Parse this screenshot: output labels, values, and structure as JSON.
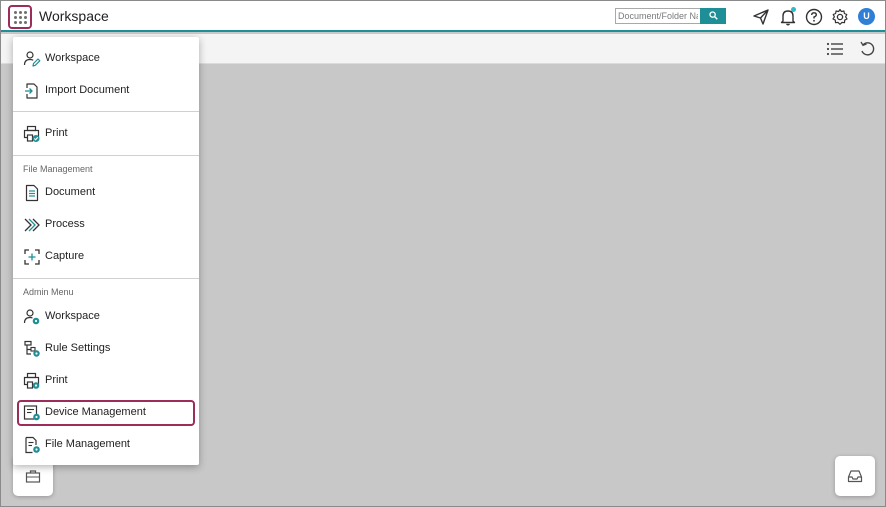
{
  "header": {
    "title": "Workspace",
    "search_placeholder": "Document/Folder Name",
    "avatar_initial": "U"
  },
  "menu": {
    "group1": [
      {
        "label": "Workspace",
        "icon": "user-edit-icon"
      },
      {
        "label": "Import Document",
        "icon": "import-document-icon"
      }
    ],
    "group2": [
      {
        "label": "Print",
        "icon": "printer-check-icon"
      }
    ],
    "file_management": {
      "heading": "File Management",
      "items": [
        {
          "label": "Document",
          "icon": "document-icon"
        },
        {
          "label": "Process",
          "icon": "process-chevrons-icon"
        },
        {
          "label": "Capture",
          "icon": "capture-icon"
        }
      ]
    },
    "admin_menu": {
      "heading": "Admin Menu",
      "items": [
        {
          "label": "Workspace",
          "icon": "user-gear-icon"
        },
        {
          "label": "Rule Settings",
          "icon": "rule-settings-icon"
        },
        {
          "label": "Print",
          "icon": "printer-gear-icon"
        },
        {
          "label": "Device Management",
          "icon": "device-gear-icon"
        },
        {
          "label": "File Management",
          "icon": "file-gear-icon"
        }
      ]
    }
  },
  "colors": {
    "accent": "#1e8f96",
    "highlight": "#9c2d5a",
    "avatar": "#2f7fd6",
    "canvas": "#c8c8c8"
  }
}
